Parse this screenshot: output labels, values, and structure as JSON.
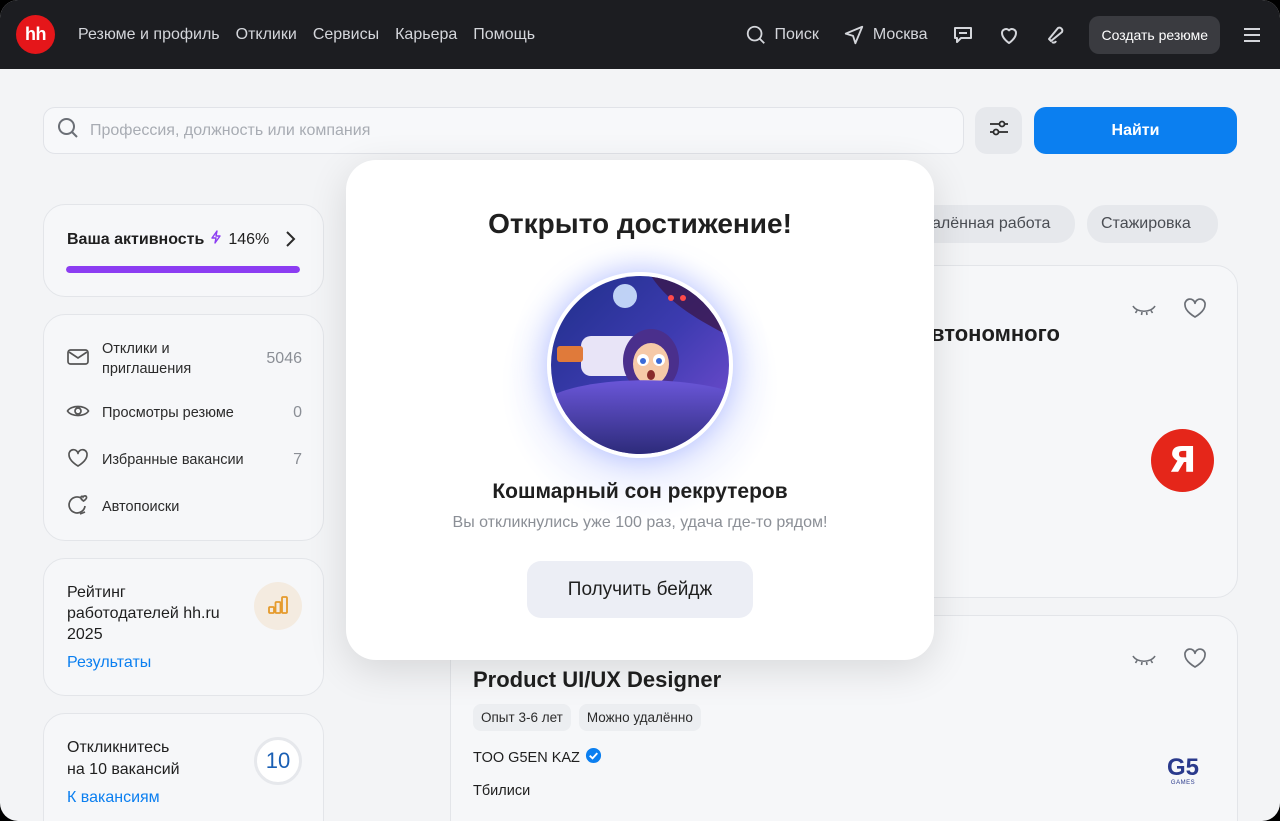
{
  "header": {
    "logo": "hh",
    "nav": [
      "Резюме и профиль",
      "Отклики",
      "Сервисы",
      "Карьера",
      "Помощь"
    ],
    "search_label": "Поиск",
    "location_label": "Москва",
    "create_resume": "Создать резюме"
  },
  "search": {
    "placeholder": "Профессия, должность или компания",
    "find_label": "Найти"
  },
  "sidebar": {
    "activity": {
      "title": "Ваша активность",
      "percent": "146%",
      "progress_fraction": 1.0
    },
    "stats": [
      {
        "label_line1": "Отклики и",
        "label_line2": "приглашения",
        "value": "5046"
      },
      {
        "label": "Просмотры резюме",
        "value": "0"
      },
      {
        "label": "Избранные вакансии",
        "value": "7"
      },
      {
        "label": "Автопоиски"
      }
    ],
    "rating": {
      "line1": "Рейтинг",
      "line2": "работодателей hh.ru",
      "line3": "2025",
      "link": "Результаты"
    },
    "respond": {
      "line1": "Откликнитесь",
      "line2": "на 10 вакансий",
      "count": "10",
      "link": "К вакансиям"
    }
  },
  "filters": [
    "алённая работа",
    "Стажировка"
  ],
  "vacancies": [
    {
      "title_fragment": "втономного"
    },
    {
      "title": "Product UI/UX Designer",
      "tags": [
        "Опыт 3-6 лет",
        "Можно удалённо"
      ],
      "company": "TOO G5EN KAZ",
      "city": "Тбилиси",
      "logo_text": "G5",
      "logo_sub": "GAMES"
    }
  ],
  "company_logo_1": "Я",
  "modal": {
    "title": "Открыто достижение!",
    "badge_name": "Кошмарный сон рекрутеров",
    "description": "Вы откликнулись уже 100 раз, удача где-то рядом!",
    "button": "Получить бейдж"
  },
  "colors": {
    "accent": "#0b7ff0",
    "brand": "#e5161a",
    "progress": "#8c3df2",
    "header_bg": "#1c1d21"
  }
}
